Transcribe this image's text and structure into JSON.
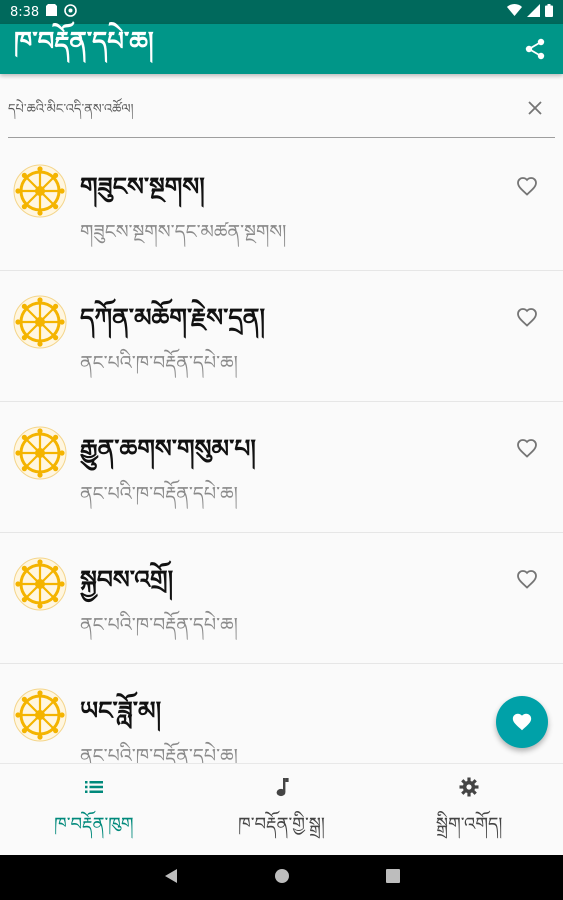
{
  "status_bar": {
    "time": "8:38",
    "icons": [
      "storage-icon",
      "sync-icon",
      "wifi-icon",
      "signal-icon",
      "battery-icon"
    ]
  },
  "app_bar": {
    "title": "ཁ་བརྡོན་དཔེ་ཆ།",
    "action_icon": "share-icon"
  },
  "search": {
    "placeholder": "དཔེ་ཆའི་མིང་འདི་ནས་འཚོལ།",
    "value": ""
  },
  "list": {
    "items": [
      {
        "title": "གཟུངས་སྔགས།",
        "subtitle": "གཟུངས་སྔགས་དང་མཚན་སྔགས།",
        "favorite": false
      },
      {
        "title": "དཀོན་མཆོག་རྗེས་དྲན།",
        "subtitle": "ནང་པའི་ཁ་བརྡོན་དཔེ་ཆ།",
        "favorite": false
      },
      {
        "title": "རྒྱུན་ཆགས་གསུམ་པ།",
        "subtitle": "ནང་པའི་ཁ་བརྡོན་དཔེ་ཆ།",
        "favorite": false
      },
      {
        "title": "སྐྱབས་འགྲོ།",
        "subtitle": "ནང་པའི་ཁ་བརྡོན་དཔེ་ཆ།",
        "favorite": false
      },
      {
        "title": "ཡང་ཟློ་མ།",
        "subtitle": "ནང་པའི་ཁ་བརྡོན་དཔེ་ཆ།",
        "favorite": false
      }
    ]
  },
  "fab": {
    "icon": "heart-icon"
  },
  "bottom_nav": {
    "items": [
      {
        "label": "ཁ་བརྡོན་ཁུག",
        "icon": "list-icon",
        "active": true
      },
      {
        "label": "ཁ་བརྡོན་གྱི་སྒྲ།",
        "icon": "music-note-icon",
        "active": false
      },
      {
        "label": "སྒྲིག་འགོད།",
        "icon": "gear-icon",
        "active": false
      }
    ]
  },
  "colors": {
    "primary": "#009688",
    "primary_dark": "#00695c",
    "accent": "#00a1a8",
    "wheel": "#f4b400"
  }
}
